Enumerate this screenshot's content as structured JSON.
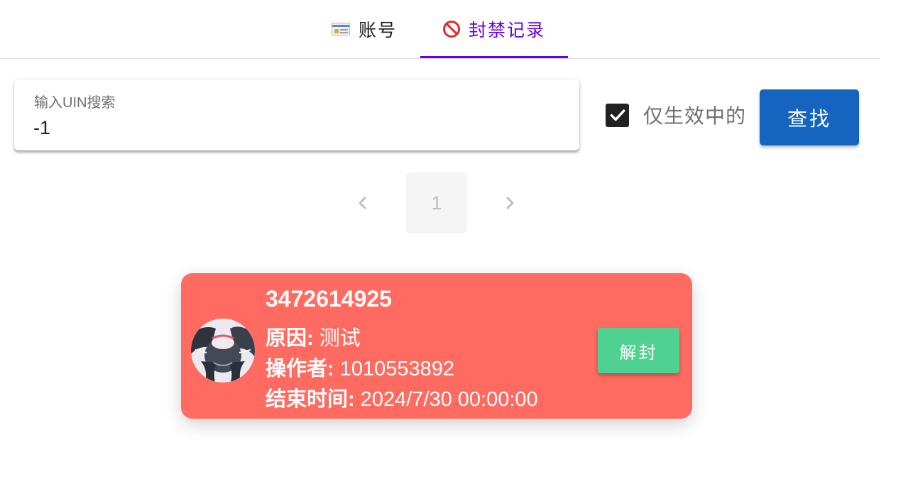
{
  "tabs": {
    "accounts": {
      "label": "账号",
      "icon": "id-card-icon"
    },
    "bans": {
      "label": "封禁记录",
      "icon": "prohibited-icon",
      "selected": true
    }
  },
  "colors": {
    "accent": "#6200ea",
    "primary_button": "#1565c0",
    "ban_card": "#ff6b60",
    "unban_button": "#4fd192"
  },
  "search": {
    "label": "输入UIN搜索",
    "value": "-1"
  },
  "filter": {
    "active_only_label": "仅生效中的",
    "active_only_checked": true
  },
  "find_button_label": "查找",
  "pagination": {
    "current_page": "1",
    "prev_icon": "chevron-left-icon",
    "next_icon": "chevron-right-icon"
  },
  "ban": {
    "uin": "3472614925",
    "reason_key": "原因:",
    "reason": "测试",
    "operator_key": "操作者:",
    "operator": "1010553892",
    "end_key": "结束时间:",
    "end_time": "2024/7/30 00:00:00",
    "unban_label": "解封"
  }
}
